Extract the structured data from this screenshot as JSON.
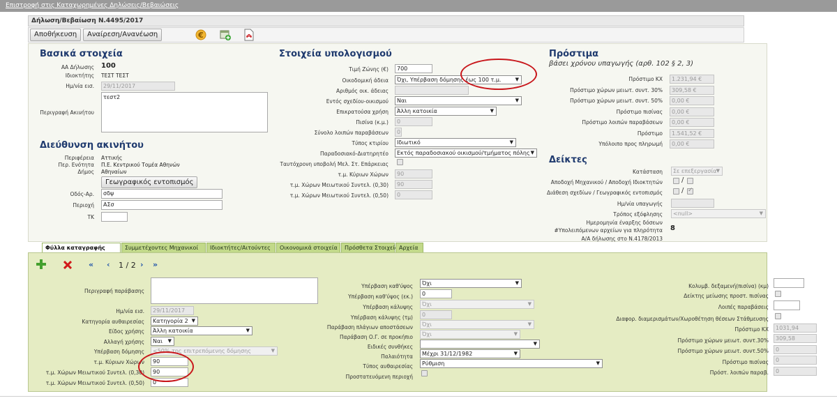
{
  "topbar": {
    "back_link": "Επιστροφή στις Καταχωρημένες Δηλώσεις/Βεβαιώσεις"
  },
  "titlebar": {
    "title": "Δήλωση/Βεβαίωση Ν.4495/2017"
  },
  "toolbar": {
    "save_label": "Αποθήκευση",
    "refresh_label": "Αναίρεση/Ανανέωση",
    "icons": [
      "euro-icon",
      "add-document-icon",
      "pdf-icon"
    ]
  },
  "basic": {
    "title": "Βασικά στοιχεία",
    "aa_label": "ΑΑ Δήλωσης",
    "aa_value": "100",
    "owner_label": "Ιδιοκτήτης",
    "owner_value": "ΤΕΣΤ ΤΕΣΤ",
    "date_label": "Ημ/νία εισ.",
    "date_value": "29/11/2017",
    "desc_label": "Περιγραφή Ακινήτου",
    "desc_value": "τεστ2"
  },
  "address": {
    "title": "Διεύθυνση ακινήτου",
    "region_label": "Περιφέρεια",
    "region_value": "Αττικής",
    "unit_label": "Περ. Ενότητα",
    "unit_value": "Π.Ε. Κεντρικού Τομέα Αθηνών",
    "municipality_label": "Δήμος",
    "municipality_value": "Αθηναίων",
    "geo_button": "Γεωγραφικός εντοπισμός",
    "street_label": "Οδός-Αρ.",
    "street_value": "σδψ",
    "area_label": "Περιοχή",
    "area_value": "ΑΣσ",
    "tk_label": "ΤΚ",
    "tk_value": ""
  },
  "calc": {
    "title": "Στοιχεία υπολογισμού",
    "zone_price_label": "Τιμή Ζώνης (€)",
    "zone_price_value": "700",
    "permit_label": "Οικοδομική άδεια",
    "permit_value": "Όχι, Υπέρβαση δόμησης έως 100 τ.μ.",
    "permit_no_label": "Αριθμός οικ. άδειας",
    "permit_no_value": "",
    "in_plan_label": "Εντός σχεδίου-οικισμού",
    "in_plan_value": "Ναι",
    "use_label": "Επικρατούσα χρήση",
    "use_value": "Άλλη κατοικία",
    "pool_label": "Πισίνα (κ.μ.)",
    "pool_value": "0",
    "other_label": "Σύνολο λοιπών παραβάσεων",
    "other_value": "0",
    "building_type_label": "Τύπος κτιρίου",
    "building_type_value": "Ιδιωτικό",
    "traditional_label": "Παραδοσιακό-Διατηρητέο",
    "traditional_value": "Εκτός παραδοσιακού οικισμού/τμήματος πόλης",
    "simultaneous_label": "Ταυτόχρονη υποβολή Μελ. Στ. Επάρκειας",
    "main_area_label": "τ.μ. Κύριων Χώρων",
    "main_area_value": "90",
    "aux30_label": "τ.μ. Χώρων Μειωτικού Συντελ. (0,30)",
    "aux30_value": "90",
    "aux50_label": "τ.μ. Χώρων Μειωτικού Συντελ. (0,50)",
    "aux50_value": "0"
  },
  "fines": {
    "title": "Πρόστιμα",
    "subtitle": "βάσει χρόνου υπαγωγής (αρθ. 102 § 2, 3)",
    "rows": [
      {
        "label": "Πρόστιμο ΚΧ",
        "value": "1.231,94 €"
      },
      {
        "label": "Πρόστιμο χώρων μειωτ. συντ. 30%",
        "value": "309,58 €"
      },
      {
        "label": "Πρόστιμο χώρων μειωτ. συντ. 50%",
        "value": "0,00 €"
      },
      {
        "label": "Πρόστιμο πισίνας",
        "value": "0,00 €"
      },
      {
        "label": "Πρόστιμο λοιπών παραβάσεων",
        "value": "0,00 €"
      },
      {
        "label": "Πρόστιμο",
        "value": "1.541,52 €"
      },
      {
        "label": "Υπόλοιπο προς πληρωμή",
        "value": "0,00 €"
      }
    ]
  },
  "indicators": {
    "title": "Δείκτες",
    "status_label": "Κατάσταση",
    "status_value": "Σε επεξεργασία",
    "acceptance_label": "Αποδοχή Μηχανικού / Αποδοχή Ιδιοκτητών",
    "plans_label": "Διάθεση σχεδίων / Γεωγραφικός εντοπισμός",
    "submit_date_label": "Ημ/νία υπαγωγής",
    "submit_date_value": "",
    "payment_label": "Τρόπος εξόφλησης",
    "payment_value": "<null>",
    "start_date_label": "Ημερομηνία έναρξης δόσεων",
    "remaining_label": "#Υπολειπόμενων αρχείων για πληρότητα",
    "remaining_value": "8",
    "aa_4178_label": "Α/Α δήλωσης στο Ν.4178/2013"
  },
  "tabs": [
    "Φύλλα καταγραφής",
    "Συμμετέχοντες Μηχανικοί",
    "Ιδιοκτήτες/Αιτούντες",
    "Οικονομικά στοιχεία",
    "Πρόσθετα Στοιχεία",
    "Αρχεία"
  ],
  "sheet": {
    "pager_text": "1 / 2",
    "desc_label": "Περιγραφή παράβασης",
    "desc_value": "",
    "date_label": "Ημ/νία εισ.",
    "date_value": "29/11/2017",
    "category_label": "Κατηγορία αυθαιρεσίας",
    "category_value": "Κατηγορία 2",
    "use_kind_label": "Είδος χρήσης",
    "use_kind_value": "Άλλη κατοικία",
    "use_change_label": "Αλλαγή χρήσης",
    "use_change_value": "Ναι",
    "over_build_label": "Υπέρβαση δόμησης",
    "over_build_value": "<50% της επιτρεπόμενης δόμησης",
    "main_area_label": "τ.μ. Κύριων Χώρων",
    "main_area_value": "90",
    "aux30_label": "τ.μ. Χώρων Μειωτικού Συντελ. (0,30)",
    "aux30_value": "90",
    "aux50_label": "τ.μ. Χώρων Μειωτικού Συντελ. (0,50)",
    "aux50_value": "0",
    "height_over_label": "Υπέρβαση καθ'ύψος",
    "height_over_value": "Όχι",
    "height_over_m_label": "Υπέρβαση καθ'ύψος (εκ.)",
    "height_over_m_value": "0",
    "coverage_label": "Υπέρβαση κάλυψης",
    "coverage_value": "Όχι",
    "coverage_sqm_label": "Υπέρβαση κάλυψης (τμ)",
    "coverage_sqm_value": "0",
    "side_dist_label": "Παράβαση πλάγιων αποστάσεων",
    "side_dist_value": "Όχι",
    "og_label": "Παράβαση Ο.Γ. σε προκήπιο",
    "og_value": "Όχι",
    "special_label": "Ειδικές συνθήκες",
    "special_value": "",
    "age_label": "Παλαιότητα",
    "age_value": "Μέχρι 31/12/1982",
    "type_label": "Τύπος αυθαιρεσίας",
    "type_value": "Ρύθμιση",
    "protected_label": "Προστατευόμενη περιοχή",
    "pool_label": "Κολυμβ. δεξαμενή(πισίνα) (κμ)",
    "pool_value": "",
    "pool_reduce_label": "Δείκτης μείωσης προστ. πισίνας",
    "other_label": "Λοιπές παραβάσεις",
    "other_value": "",
    "parking_label": "Διαφορ. διαμερισμάτων/Χωροθέτηση θέσεων Στάθμευσης",
    "fine_kx_label": "Πρόστιμο ΚΧ",
    "fine_kx_value": "1031,94",
    "fine30_label": "Πρόστιμο χώρων μειωτ. συντ.30%",
    "fine30_value": "309,58",
    "fine50_label": "Πρόστιμο χώρων μειωτ. συντ.50%",
    "fine50_value": "0",
    "fine_pool_label": "Πρόστιμο πισίνας",
    "fine_pool_value": "0",
    "fine_other_label": "Πρόστ. λοιπών παραβ.",
    "fine_other_value": "0"
  },
  "colors": {
    "heading": "#1f3a6e",
    "green_panel": "#e5ecc3",
    "tab": "#c2d98a",
    "annotation": "#c8161b"
  }
}
